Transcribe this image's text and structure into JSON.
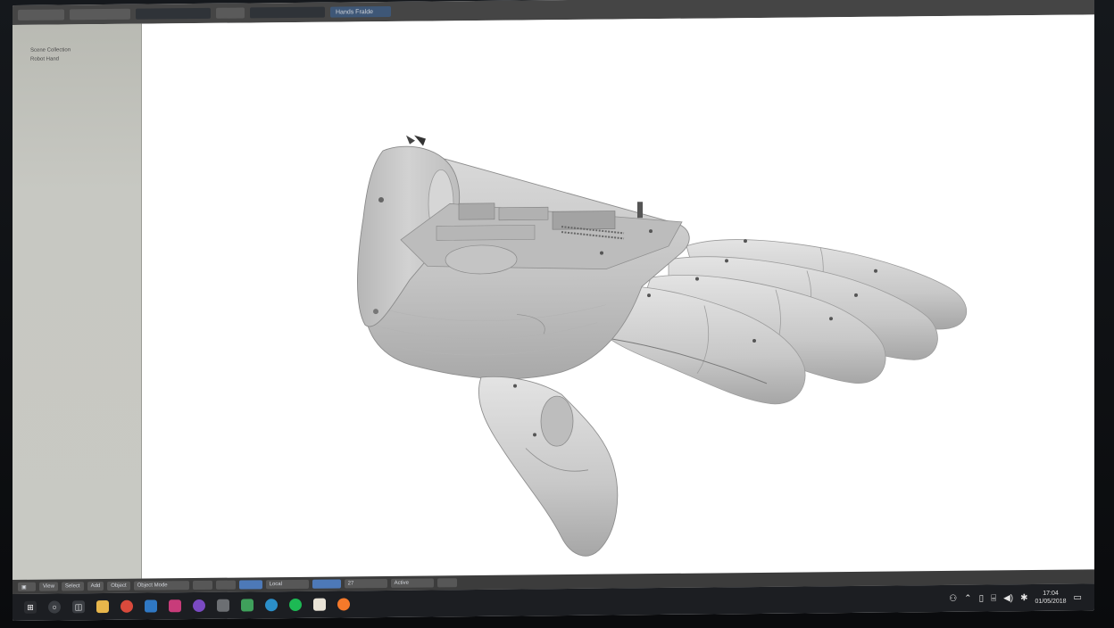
{
  "header": {
    "menus": [
      "",
      "",
      ""
    ],
    "tabs": [
      {
        "label": "",
        "kind": "dark"
      },
      {
        "label": "",
        "kind": "dark"
      },
      {
        "label": "Hands Fralde",
        "kind": "blue"
      }
    ]
  },
  "outliner": {
    "items": [
      "Scene Collection",
      "Robot Hand"
    ]
  },
  "viewport_footer": {
    "view_menu": "View",
    "select_menu": "Select",
    "add_menu": "Add",
    "object_menu": "Object",
    "mode": "Object Mode",
    "pivot": "Local",
    "layer": "Active",
    "frame": "27"
  },
  "taskbar": {
    "time": "17:04",
    "date": "01/05/2018"
  },
  "colors": {
    "viewport_bg": "#ffffff",
    "model_fill": "#c9c9c9",
    "selection_accent": "#4f7fc5"
  }
}
